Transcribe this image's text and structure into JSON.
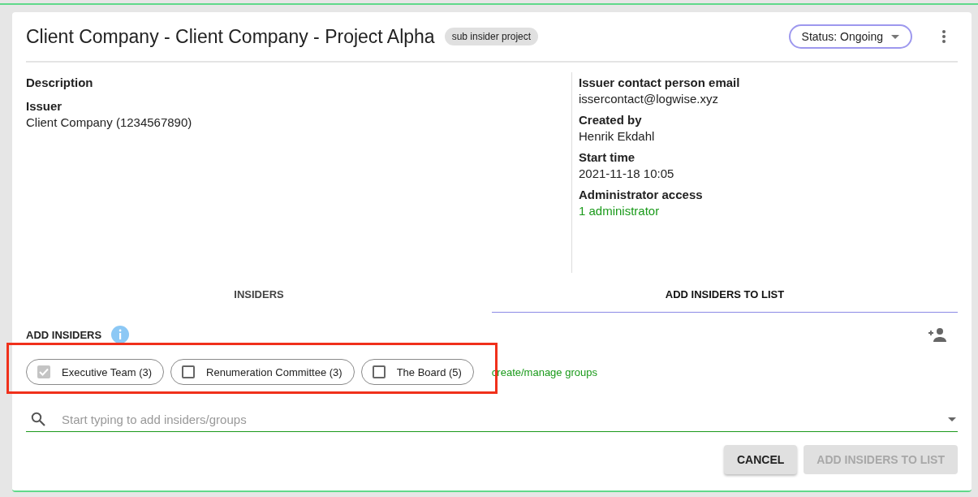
{
  "title": "Client Company - Client Company - Project Alpha",
  "badge": "sub insider project",
  "status": {
    "label": "Status: Ongoing"
  },
  "details_left": [
    {
      "label": "Description"
    },
    {
      "label": "Issuer",
      "value": "Client Company (1234567890)",
      "kind": "text"
    }
  ],
  "details_right": [
    {
      "label": "Issuer contact person email",
      "value": "issercontact@logwise.xyz",
      "kind": "text"
    },
    {
      "label": "Created by",
      "value": "Henrik Ekdahl",
      "kind": "text"
    },
    {
      "label": "Start time",
      "value": "2021-11-18 10:05",
      "kind": "text"
    },
    {
      "label": "Administrator access",
      "value": "1 administrator",
      "kind": "link"
    }
  ],
  "tabs": [
    {
      "label": "INSIDERS",
      "selected": false
    },
    {
      "label": "ADD INSIDERS TO LIST",
      "selected": true
    }
  ],
  "add_insiders": {
    "heading": "ADD INSIDERS",
    "highlighted": true,
    "groups": [
      {
        "label": "Executive Team (3)",
        "checked": true,
        "disabled": true
      },
      {
        "label": "Renumeration Committee (3)",
        "checked": false,
        "disabled": false
      },
      {
        "label": "The Board (5)",
        "checked": false,
        "disabled": false
      }
    ],
    "manage_link": "create/manage groups"
  },
  "search": {
    "placeholder": "Start typing to add insiders/groups"
  },
  "buttons": [
    {
      "label": "CANCEL",
      "disabled": false
    },
    {
      "label": "ADD INSIDERS TO LIST",
      "disabled": true
    }
  ]
}
